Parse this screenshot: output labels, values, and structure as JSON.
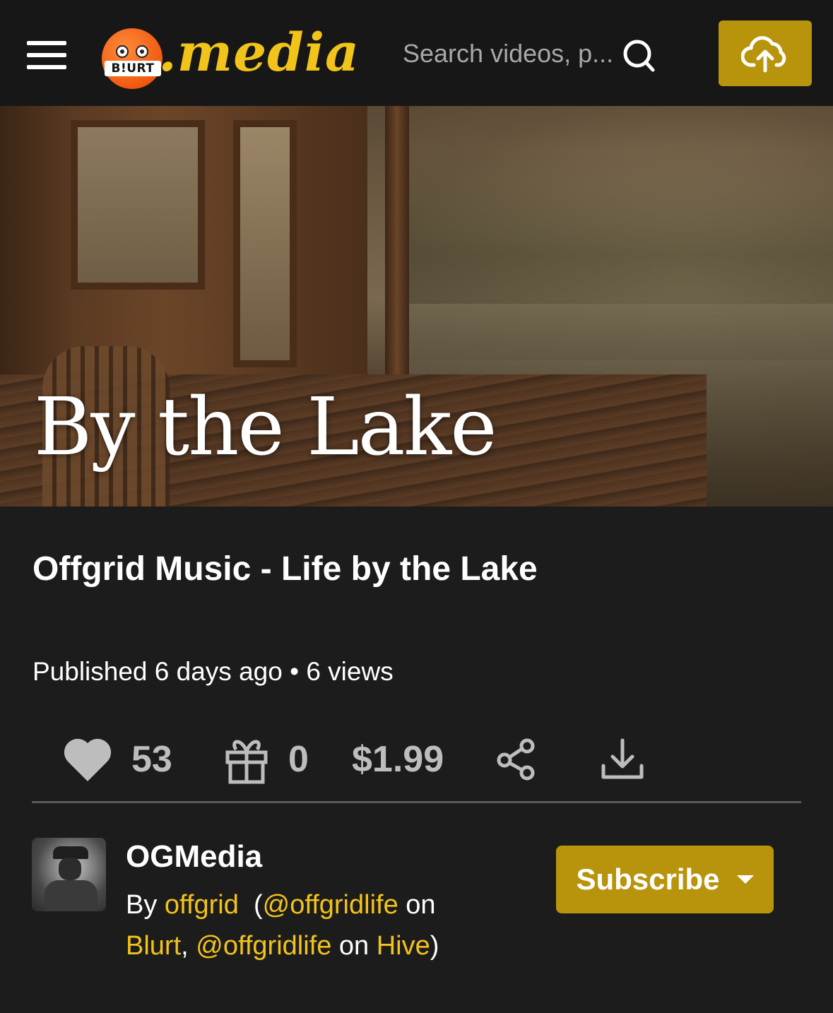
{
  "header": {
    "logo_band": "B!URT",
    "logo_text": ".media",
    "search_placeholder": "Search videos, p...",
    "accent_color": "#b8940c"
  },
  "hero": {
    "title": "By the Lake"
  },
  "video": {
    "title": "Offgrid Music - Life by the Lake",
    "meta": "Published 6 days ago • 6 views"
  },
  "actions": {
    "likes": "53",
    "gifts": "0",
    "price": "$1.99"
  },
  "channel": {
    "name": "OGMedia",
    "by_prefix": "By ",
    "author": "offgrid",
    "open_paren": "(",
    "blurt_handle": "@offgridlife",
    "on1": " on ",
    "blurt": "Blurt",
    "comma": ", ",
    "hive_handle": "@offgridlife",
    "on2": " on ",
    "hive": "Hive",
    "close_paren": ")",
    "subscribe_label": "Subscribe"
  }
}
